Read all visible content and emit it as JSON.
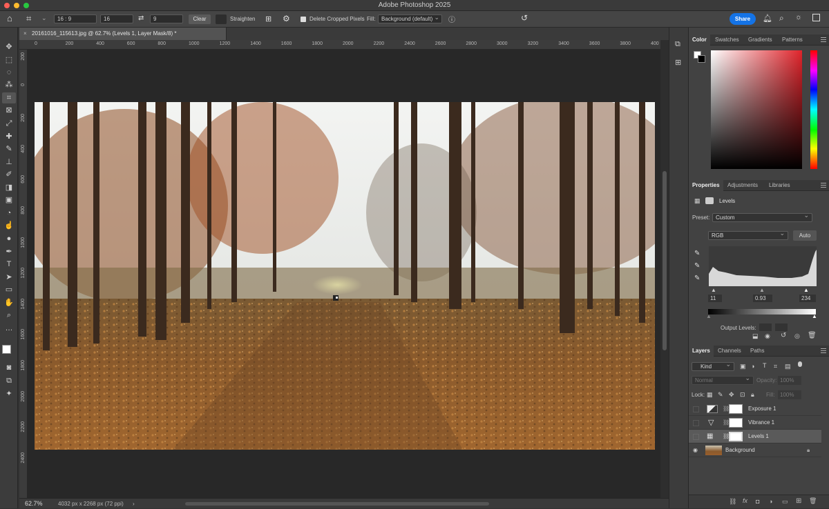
{
  "app": {
    "title": "Adobe Photoshop 2025"
  },
  "options": {
    "ratio": "16 : 9",
    "width": "16",
    "height": "9",
    "clear": "Clear",
    "straighten": "Straighten",
    "delete_cropped": "Delete Cropped Pixels",
    "fill_label": "Fill:",
    "fill_value": "Background (default)",
    "share": "Share"
  },
  "document": {
    "tab": "20161016_115613.jpg @ 62.7% (Levels 1, Layer Mask/8) *",
    "zoom": "62.7%",
    "info": "4032 px x 2268 px (72 ppi)"
  },
  "ruler": {
    "top": [
      "0",
      "200",
      "400",
      "600",
      "800",
      "1000",
      "1200",
      "1400",
      "1600",
      "1800",
      "2000",
      "2200",
      "2400",
      "2600",
      "2800",
      "3000",
      "3200",
      "3400",
      "3600",
      "3800",
      "400"
    ],
    "left": [
      "200",
      "0",
      "200",
      "400",
      "600",
      "800",
      "1000",
      "1200",
      "1400",
      "1600",
      "1800",
      "2000",
      "2200",
      "2400"
    ]
  },
  "colorPanel": {
    "tabs": [
      "Color",
      "Swatches",
      "Gradients",
      "Patterns"
    ]
  },
  "propertiesPanel": {
    "tabs": [
      "Properties",
      "Adjustments",
      "Libraries"
    ],
    "title": "Levels",
    "preset_label": "Preset:",
    "preset": "Custom",
    "channel": "RGB",
    "auto": "Auto",
    "input_black": "11",
    "input_gamma": "0.93",
    "input_white": "234",
    "output_label": "Output Levels:"
  },
  "layersPanel": {
    "tabs": [
      "Layers",
      "Channels",
      "Paths"
    ],
    "filter": "Kind",
    "blend": "Normal",
    "opacity_label": "Opacity:",
    "opacity": "100%",
    "lock_label": "Lock:",
    "fill_label": "Fill:",
    "fill": "100%",
    "layers": [
      {
        "name": "Exposure 1"
      },
      {
        "name": "Vibrance 1"
      },
      {
        "name": "Levels 1"
      },
      {
        "name": "Background"
      }
    ]
  },
  "icons": {
    "home": "home-icon",
    "crop": "crop-icon",
    "swap": "swap-icon",
    "grid": "grid-overlay-icon",
    "gear": "gear-icon",
    "undo": "reset-icon",
    "bell": "bell-icon",
    "search": "search-icon",
    "bulb": "lightbulb-icon",
    "layout": "workspace-icon"
  },
  "colors": {
    "accent": "#1473e6",
    "panel": "#424242"
  }
}
